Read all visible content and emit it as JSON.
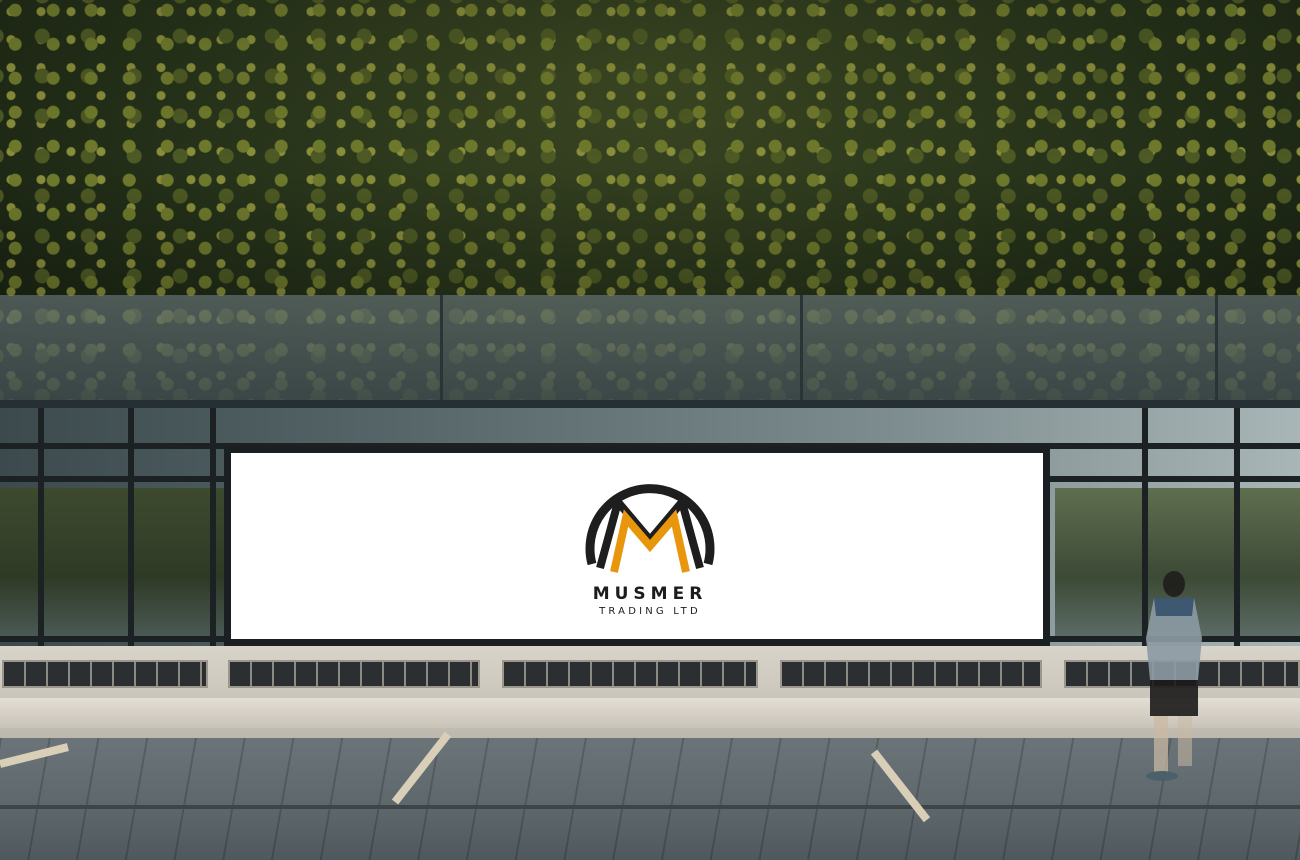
{
  "billboard": {
    "brand_name": "MUSMER",
    "tagline": "TRADING LTD"
  },
  "colors": {
    "logo_dark": "#1e1e1e",
    "logo_accent": "#e8960c",
    "billboard_bg": "#ffffff"
  },
  "icons": {
    "logo": "m-monogram-logo",
    "person": "pedestrian-figure"
  }
}
